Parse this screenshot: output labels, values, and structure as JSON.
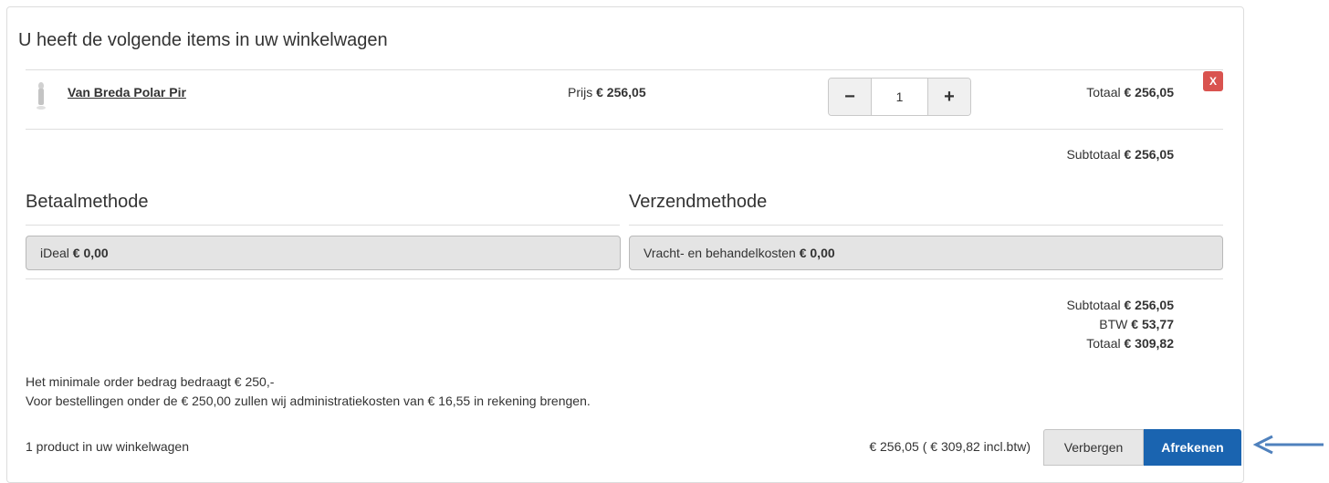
{
  "cart": {
    "heading": "U heeft de volgende items in uw winkelwagen",
    "items": [
      {
        "name": "Van Breda Polar Pir",
        "price_label": "Prijs",
        "price": "€ 256,05",
        "quantity": "1",
        "minus": "−",
        "plus": "+",
        "total_label": "Totaal",
        "total": "€ 256,05",
        "remove": "X"
      }
    ],
    "subtotal_label": "Subtotaal",
    "subtotal": "€ 256,05"
  },
  "payment": {
    "title": "Betaalmethode",
    "selected_label": "iDeal",
    "selected_amount": "€ 0,00"
  },
  "shipping": {
    "title": "Verzendmethode",
    "selected_label": "Vracht- en behandelkosten",
    "selected_amount": "€ 0,00"
  },
  "summary": {
    "subtotal_label": "Subtotaal",
    "subtotal": "€ 256,05",
    "vat_label": "BTW",
    "vat": "€ 53,77",
    "total_label": "Totaal",
    "total": "€ 309,82"
  },
  "notes": {
    "line1": "Het minimale order bedrag bedraagt € 250,-",
    "line2": "Voor bestellingen onder de € 250,00 zullen wij administratiekosten van € 16,55 in rekening brengen."
  },
  "footer": {
    "count": "1 product in uw winkelwagen",
    "sum": "€ 256,05 ( € 309,82 incl.btw)",
    "hide_label": "Verbergen",
    "checkout_label": "Afrekenen",
    "accent": "#1a64b0"
  }
}
